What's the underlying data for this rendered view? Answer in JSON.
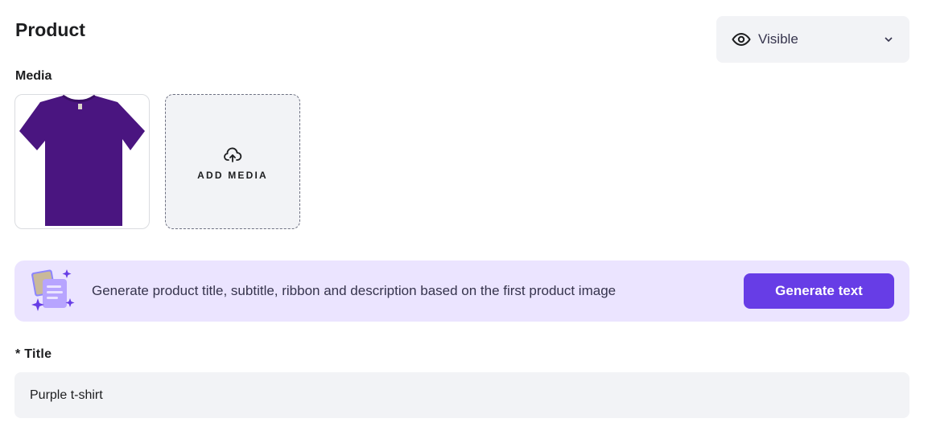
{
  "page": {
    "title": "Product"
  },
  "visibility": {
    "value": "Visible",
    "icon": "eye-icon"
  },
  "media": {
    "label": "Media",
    "add_label": "ADD MEDIA",
    "items": [
      {
        "kind": "t-shirt",
        "color": "#4a1580"
      }
    ]
  },
  "ai": {
    "text": "Generate product title, subtitle, ribbon and description based on the first product image",
    "button": "Generate text"
  },
  "title_field": {
    "label": "* Title",
    "value": "Purple t-shirt"
  },
  "colors": {
    "accent": "#673de6",
    "banner": "#ebe4ff",
    "field_bg": "#f2f3f6"
  }
}
